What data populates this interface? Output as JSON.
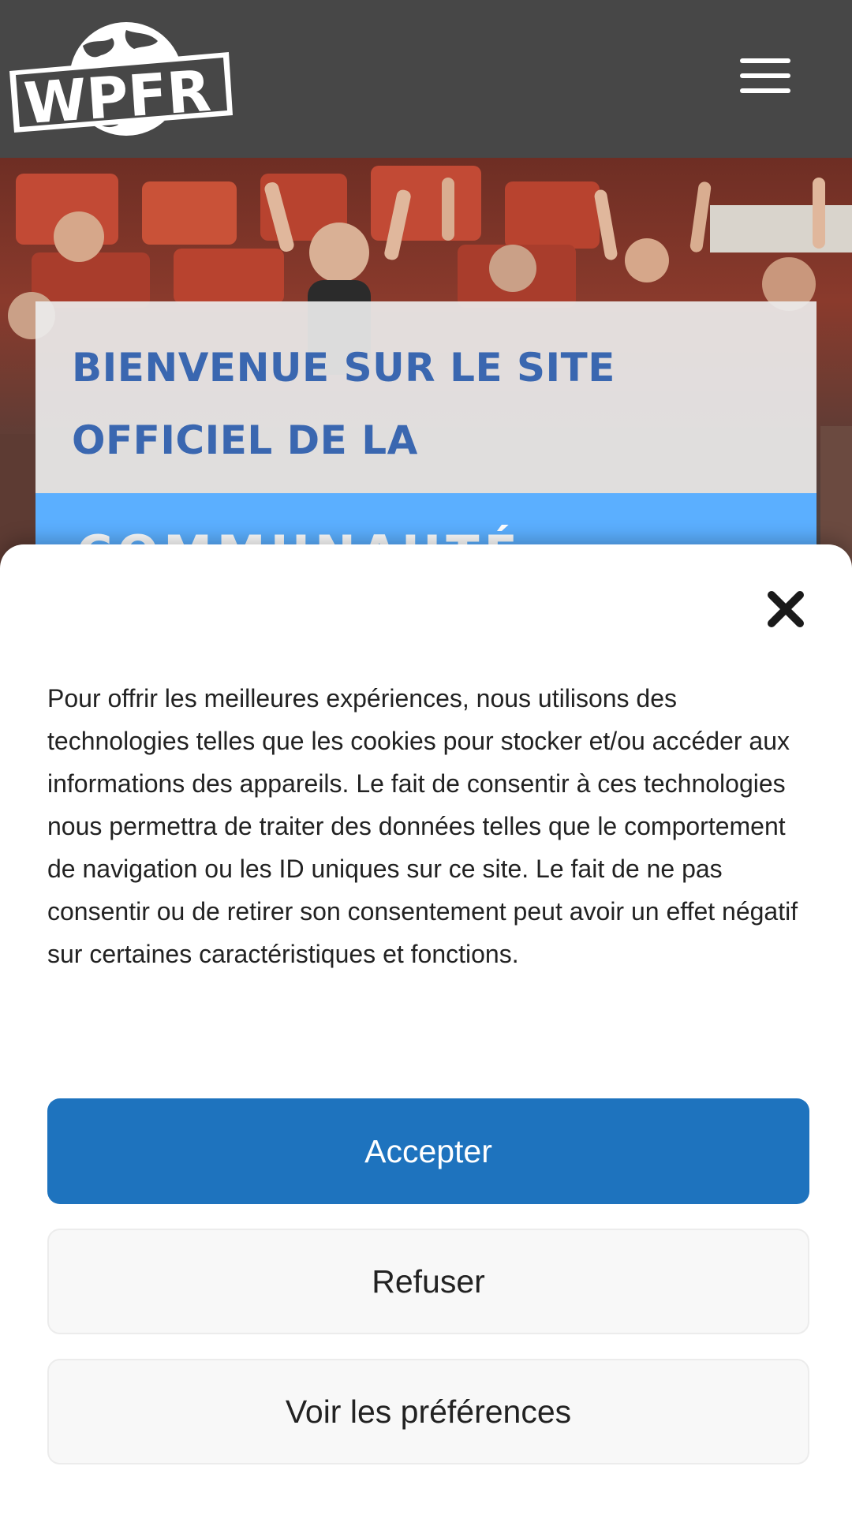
{
  "header": {
    "logo_text": "WPFR",
    "background_color": "#474747",
    "menu_icon": "hamburger-menu-icon"
  },
  "hero": {
    "title": "BIENVENUE SUR LE SITE OFFICIEL DE LA",
    "subtitle": "COMMUNAUTÉ",
    "title_color": "#3a67b0",
    "band_color": "#5bafff"
  },
  "cookie_banner": {
    "close_icon": "close-icon",
    "message": "Pour offrir les meilleures expériences, nous utilisons des technologies telles que les cookies pour stocker et/ou accéder aux informations des appareils. Le fait de consentir à ces technologies nous permettra de traiter des données telles que le comportement de navigation ou les ID uniques sur ce site. Le fait de ne pas consentir ou de retirer son consentement peut avoir un effet négatif sur certaines caractéristiques et fonctions.",
    "accept_label": "Accepter",
    "refuse_label": "Refuser",
    "preferences_label": "Voir les préférences",
    "accept_color": "#1e73be"
  }
}
